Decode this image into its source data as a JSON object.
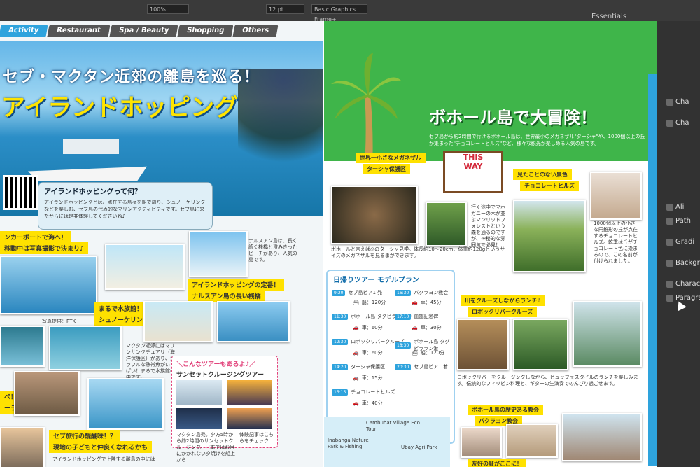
{
  "app": {
    "workspace": "Essentials",
    "zoom": "100%",
    "font_size": "12 pt",
    "graphic_frame": "Basic Graphics Frame+"
  },
  "panel": {
    "items": [
      "Cha",
      "Cha",
      "Ali",
      "Path",
      "Gradi",
      "Backgr",
      "Characte",
      "Paragra"
    ]
  },
  "left_page": {
    "tabs": [
      "Activity",
      "Restaurant",
      "Spa / Beauty",
      "Shopping",
      "Others"
    ],
    "headline_small": "セブ・マクタン近郊の離島を巡る！",
    "headline_big": "アイランドホッピング",
    "info_title": "アイランドホッピングって何？",
    "info_body": "アイランドホッピングとは、点在する島々を船で周り、シュノーケリングなどを楽しむ、セブ島の代表的なマリンアクティビティです。セブ島に来たからには是非体験してくださいね♪",
    "ribbons": [
      "ンカーボートで海へ！",
      "移動中は写真撮影で決まり♪",
      "まるで水族館！",
      "シュノーケリング",
      "アイランドホッピングの定番！",
      "ナルスアン島の長い桟橋",
      "ぺ！",
      "ーランチ",
      "セブ旅行の醍醐味！？",
      "現地の子どもと仲良くなれるかも"
    ],
    "side_text": "ナルスアン島は、長く続く桟橋と澄みきったビーチがあり、人気の島です。",
    "aquarium_text": "マクタン近郊にはマリンサンクチュアリ（海洋保護区）があり、カラフルな熱帯魚がいっぱい！まるで水族館の中です。",
    "photo_credit": "写真提供：PTK",
    "tour_title": "＼こんなツアーもあるよ♪／",
    "tour_name": "サンセットクルージングツアー",
    "tour_body": "マクタン島発。夕方5時から約2時間のサンセットクルージング。日本ではお目にかかれない夕焼けを船上から",
    "tour_more": "体験記事はこちらをチェック",
    "bottom_text": "アイランドホッピングで上陸する離島の中には"
  },
  "right_page": {
    "title": "ボホール島で大冒険！",
    "lead": "セブ島から約2時間で行けるボホール島は、世界最小のメガネザル\"ターシャ\"や、1000個以上の丘が集まった\"チョコレートヒルズ\"など、様々な観光が楽しめる人気の島です。",
    "sign": [
      "THIS",
      "WAY"
    ],
    "tags": [
      "世界一小さなメガネザル",
      "ターシャ保護区",
      "見たことのない景色",
      "チョコレートヒルズ",
      "川をクルーズしながらランチ♪",
      "ロボックリバークルーズ",
      "ボホール島の歴史ある教会",
      "バクラヨン教会",
      "友好の証がここに！"
    ],
    "tarsier_text": "ボホールと言えば◎のターシャ見学。体長約10〜20cm、体重約120gというサイズのメガネザルを見る事ができます。",
    "hills_text": "1000個以上の小さな円錐形の丘が点在するチョコレートヒルズ。乾季は丘がチョコレート色に染まるので、この名前が付けられました。",
    "forest_text": "行く途中でマホガニーの木が並ぶマンリッドフォレストという森を通るのですが、神秘的な雰囲気で必見！",
    "river_text": "ロボックリバーをクルージングしながら、ビュッフェスタイルのランチを楽しみます。伝統的なフィリピン料理と、ギターの生演奏でのんびり過ごせます。",
    "itinerary": {
      "title": "日帰りツアー モデルプラン",
      "rows": [
        {
          "time": "9:20",
          "place": "セブ島ピア1 発",
          "dur": "船：120分"
        },
        {
          "time": "11:30",
          "place": "ボホール島 タグビララン港",
          "dur": "車：60分"
        },
        {
          "time": "12:30",
          "place": "ロボックリバークルーズ",
          "dur": "車：60分"
        },
        {
          "time": "14:20",
          "place": "ターシャ保護区",
          "dur": "車：15分"
        },
        {
          "time": "15:15",
          "place": "チョコレートヒルズ",
          "dur": "車：40分"
        },
        {
          "time": "16:30",
          "place": "バクラヨン教会",
          "dur": "車：45分"
        },
        {
          "time": "17:10",
          "place": "血盟記念碑",
          "dur": "車：30分"
        },
        {
          "time": "18:30",
          "place": "ボホール島 タグビララン港",
          "dur": "船：120分"
        },
        {
          "time": "20:30",
          "place": "セブ島ピア1 着",
          "dur": ""
        }
      ]
    },
    "map_labels": [
      "Cambuhat Village Eco Tour",
      "Inabanga Nature Park & Fishing",
      "Ubay Agri Park"
    ]
  }
}
